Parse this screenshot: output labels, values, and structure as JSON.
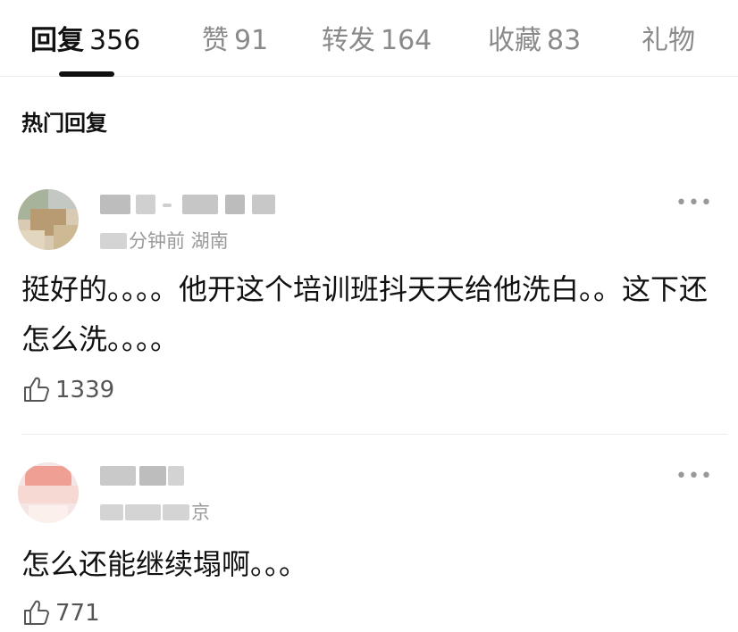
{
  "tabs": [
    {
      "label": "回复",
      "count": "356"
    },
    {
      "label": "赞",
      "count": "91"
    },
    {
      "label": "转发",
      "count": "164"
    },
    {
      "label": "收藏",
      "count": "83"
    },
    {
      "label": "礼物",
      "count": ""
    }
  ],
  "section_title": "热门回复",
  "comments": [
    {
      "meta": "分钟前 湖南",
      "text": "挺好的。。。。他开这个培训班抖天天给他洗白。。这下还怎么洗。。。。",
      "likes": "1339"
    },
    {
      "meta": "京",
      "text": "怎么还能继续塌啊。。。",
      "likes": "771"
    }
  ],
  "icons": {
    "like": "thumbs-up-icon",
    "more": "more-dots-icon"
  },
  "colors": {
    "active_tab": "#111111",
    "inactive_tab": "#8a8a8a",
    "meta": "#9a9a9a"
  }
}
